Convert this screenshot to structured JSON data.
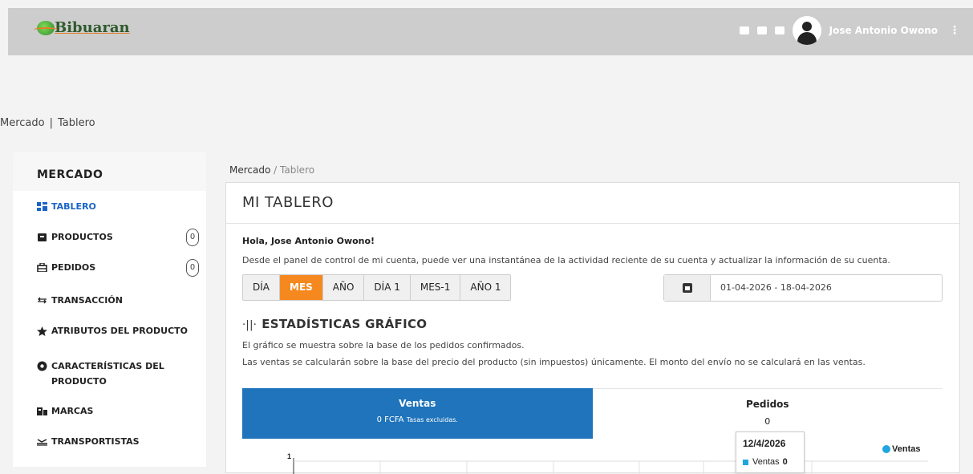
{
  "header": {
    "logo_text": "Bibuaran",
    "user_name": "Jose Antonio Owono",
    "menu_glyph": "⋮",
    "icons": [
      "monitor-icon",
      "contact-icon",
      "chat-icon"
    ]
  },
  "page_breadcrumb": {
    "a": "Mercado",
    "sep": "|",
    "b": "Tablero"
  },
  "sidebar": {
    "heading": "MERCADO",
    "items": [
      {
        "label": "TABLERO",
        "icon": "dashboard-icon",
        "active": true
      },
      {
        "label": "PRODUCTOS",
        "icon": "box-icon",
        "badge": "0"
      },
      {
        "label": "PEDIDOS",
        "icon": "orders-icon",
        "badge": "0"
      },
      {
        "label": "TRANSACCIÓN",
        "icon": "exchange-icon"
      },
      {
        "label": "ATRIBUTOS DEL PRODUCTO",
        "icon": "star-icon"
      },
      {
        "label": "CARACTERÍSTICAS DEL PRODUCTO",
        "icon": "gear-icon"
      },
      {
        "label": "MARCAS",
        "icon": "brand-icon"
      },
      {
        "label": "TRANSPORTISTAS",
        "icon": "truck-icon"
      }
    ]
  },
  "main_breadcrumb": {
    "a": "Mercado",
    "sep": "/",
    "b": "Tablero"
  },
  "card": {
    "title": "MI TABLERO",
    "greeting": "Hola, Jose Antonio Owono!",
    "intro": "Desde el panel de control de mi cuenta, puede ver una instantánea de la actividad reciente de su cuenta y actualizar la información de su cuenta.",
    "periods": [
      "DÍA",
      "MES",
      "AÑO",
      "DÍA 1",
      "MES-1",
      "AÑO 1"
    ],
    "active_period": "MES",
    "date_range": "01-04-2026 - 18-04-2026",
    "stats_glyph": "·||·",
    "stats_title": "ESTADÍSTICAS GRÁFICO",
    "note1": "El gráfico se muestra sobre la base de los pedidos confirmados.",
    "note2": "Las ventas se calcularán sobre la base del precio del producto (sin impuestos) únicamente. El monto del envío no se calculará en las ventas.",
    "tab_ventas_title": "Ventas",
    "tab_ventas_value": "0 FCFA",
    "tab_ventas_note": "Tasas excluidas.",
    "tab_pedidos_title": "Pedidos",
    "tab_pedidos_value": "0"
  },
  "chart_data": {
    "type": "line",
    "series": [
      {
        "name": "Ventas",
        "values": [
          0
        ]
      }
    ],
    "x": [
      "12/4/2026"
    ],
    "ytick_top": "1",
    "tooltip": {
      "date": "12/4/2026",
      "series": "Ventas",
      "value": "0"
    },
    "legend": "top-right",
    "colors": {
      "Ventas": "#1fa5e0"
    }
  }
}
